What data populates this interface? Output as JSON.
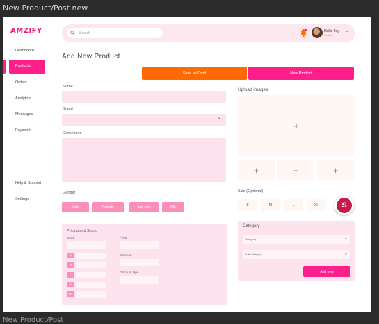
{
  "frame": {
    "title": "New Product/Post new",
    "next_frame_title": "New Product/Post"
  },
  "brand": {
    "logo": "AMZIFY",
    "accent": "#ff1f8b",
    "orange": "#ff6a00"
  },
  "header": {
    "search_placeholder": "Search",
    "notification_icon": "bell-icon",
    "user_name": "Hallie Joy",
    "user_role": "Vendor"
  },
  "sidebar": {
    "items": [
      {
        "label": "Dashboard",
        "active": false
      },
      {
        "label": "Products",
        "active": true
      },
      {
        "label": "Orders",
        "active": false
      },
      {
        "label": "Analytics",
        "active": false
      },
      {
        "label": "Messages",
        "active": false
      },
      {
        "label": "Payment",
        "active": false
      }
    ],
    "bottom_items": [
      {
        "label": "Help & Support"
      },
      {
        "label": "Settings"
      }
    ]
  },
  "main": {
    "title": "Add New Product",
    "save_draft_label": "Save as Draft",
    "new_product_label": "New Product",
    "name_label": "Name",
    "brand_label": "Brand",
    "description_label": "Description",
    "gender_label": "Gender",
    "gender_options": [
      "Male",
      "Female",
      "Uni-sex",
      "NIL"
    ],
    "pricing": {
      "title": "Pricing and Stock",
      "stock_label": "Stock",
      "price_label": "Price",
      "discount_label": "Discount",
      "discount_type_label": "Discount type",
      "size_tags": [
        "S",
        "M",
        "L",
        "XL",
        "XXL"
      ]
    },
    "upload": {
      "label": "Upload images",
      "plus": "+"
    },
    "size": {
      "label": "Size (Optional)",
      "options": [
        "S",
        "M",
        "L",
        "XL"
      ]
    },
    "category": {
      "title": "Category",
      "category_placeholder": "Category",
      "subcategory_placeholder": "Sub Category",
      "add_new_label": "Add new"
    },
    "fab_letter": "S"
  }
}
